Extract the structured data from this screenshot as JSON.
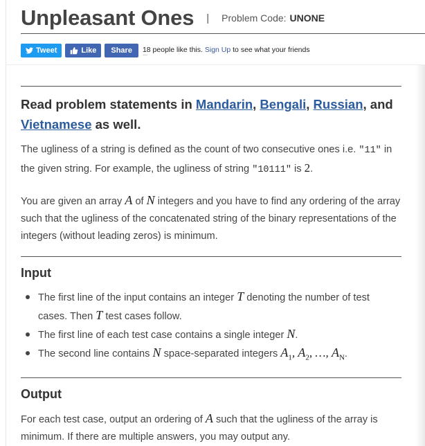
{
  "problem": {
    "title": "Unpleasant Ones",
    "code_label": "Problem Code:",
    "code_value": "UNONE"
  },
  "social": {
    "tweet_label": "Tweet",
    "like_label": "Like",
    "share_label": "Share",
    "likes_prefix": "18 people like this.",
    "signup_link": "Sign Up",
    "likes_suffix": "to see what your friends like."
  },
  "language_note": {
    "prefix": "Read problem statements in",
    "languages": [
      "Mandarin",
      "Bengali",
      "Russian",
      "Vietnamese"
    ],
    "sep1": ",",
    "sep2": ",",
    "sep3": ", and",
    "suffix": "as well."
  },
  "statement": {
    "p1_a": "The ugliness of a string is defined as the count of two consecutive ones i.e.",
    "p1_code1": "\"11\"",
    "p1_b": "in the given string. For example, the ugliness of string",
    "p1_code2": "\"10111\"",
    "p1_c": "is",
    "p1_value": "2",
    "p1_d": ".",
    "p2_a": "You are given an array",
    "p2_var_a": "A",
    "p2_b": "of",
    "p2_var_n": "N",
    "p2_c": "integers and you have to find any ordering of the array such that the ugliness of the concatenated string of the binary representations of the integers (without leading zeros) is minimum."
  },
  "input_section": {
    "heading": "Input",
    "b1_a": "The first line of the input contains an integer",
    "b1_var": "T",
    "b1_b": "denoting the number of test cases. Then",
    "b1_var2": "T",
    "b1_c": "test cases follow.",
    "b2_a": "The first line of each test case contains a single integer",
    "b2_var": "N",
    "b2_b": ".",
    "b3_a": "The second line contains",
    "b3_var": "N",
    "b3_b": "space-separated integers",
    "b3_a1": "A",
    "b3_s1": "1",
    "b3_a2": "A",
    "b3_s2": "2",
    "b3_dots": "…",
    "b3_an": "A",
    "b3_sn": "N",
    "b3_end": "."
  },
  "output_section": {
    "heading": "Output",
    "text_a": "For each test case, output an ordering of",
    "var": "A",
    "text_b": "such that the ugliness of the array is minimum. If there are multiple answers, you may output any."
  }
}
